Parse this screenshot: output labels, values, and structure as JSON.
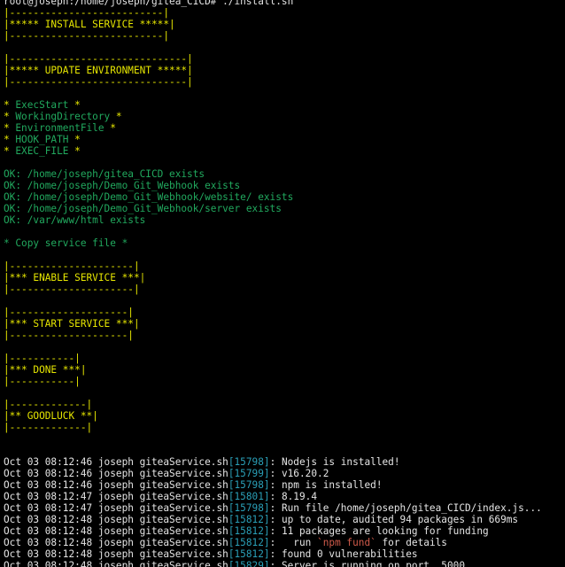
{
  "prompt": {
    "text": "root@joseph:/home/joseph/gitea_CICD# ./install.sh"
  },
  "banners": {
    "install": {
      "top": "|--------------------------|",
      "title": "|***** INSTALL SERVICE *****|",
      "bottom": "|--------------------------|"
    },
    "update": {
      "top": "|------------------------------|",
      "title": "|***** UPDATE ENVIRONMENT *****|",
      "bottom": "|------------------------------|"
    },
    "enable": {
      "top": "|---------------------|",
      "title": "|*** ENABLE SERVICE ***|",
      "bottom": "|---------------------|"
    },
    "start": {
      "top": "|--------------------|",
      "title": "|*** START SERVICE ***|",
      "bottom": "|--------------------|"
    },
    "done": {
      "top": "|-----------|",
      "title": "|*** DONE ***|",
      "bottom": "|-----------|"
    },
    "goodluck": {
      "top": "|-------------|",
      "title": "|** GOODLUCK **|",
      "bottom": "|-------------|"
    }
  },
  "env_vars": [
    {
      "prefix": "* ",
      "name": "ExecStart",
      "suffix": " *"
    },
    {
      "prefix": "* ",
      "name": "WorkingDirectory",
      "suffix": " *"
    },
    {
      "prefix": "* ",
      "name": "EnvironmentFile",
      "suffix": " *"
    },
    {
      "prefix": "* ",
      "name": "HOOK_PATH",
      "suffix": " *"
    },
    {
      "prefix": "* ",
      "name": "EXEC_FILE",
      "suffix": " *"
    }
  ],
  "ok_lines": [
    "OK: /home/joseph/gitea_CICD exists",
    "OK: /home/joseph/Demo_Git_Webhook exists",
    "OK: /home/joseph/Demo_Git_Webhook/website/ exists",
    "OK: /home/joseph/Demo_Git_Webhook/server exists",
    "OK: /var/www/html exists"
  ],
  "copy_line": "* Copy service file *",
  "log": {
    "entries": [
      {
        "time": "Oct 03 08:12:46",
        "host": "joseph",
        "proc": "giteaService.sh",
        "pid": "[15798]",
        "msg": ": Nodejs is installed!"
      },
      {
        "time": "Oct 03 08:12:46",
        "host": "joseph",
        "proc": "giteaService.sh",
        "pid": "[15799]",
        "msg": ": v16.20.2"
      },
      {
        "time": "Oct 03 08:12:46",
        "host": "joseph",
        "proc": "giteaService.sh",
        "pid": "[15798]",
        "msg": ": npm is installed!"
      },
      {
        "time": "Oct 03 08:12:47",
        "host": "joseph",
        "proc": "giteaService.sh",
        "pid": "[15801]",
        "msg": ": 8.19.4"
      },
      {
        "time": "Oct 03 08:12:47",
        "host": "joseph",
        "proc": "giteaService.sh",
        "pid": "[15798]",
        "msg": ": Run file /home/joseph/gitea_CICD/index.js..."
      },
      {
        "time": "Oct 03 08:12:48",
        "host": "joseph",
        "proc": "giteaService.sh",
        "pid": "[15812]",
        "msg": ": up to date, audited 94 packages in 669ms"
      },
      {
        "time": "Oct 03 08:12:48",
        "host": "joseph",
        "proc": "giteaService.sh",
        "pid": "[15812]",
        "msg": ": 11 packages are looking for funding"
      },
      {
        "time": "Oct 03 08:12:48",
        "host": "joseph",
        "proc": "giteaService.sh",
        "pid": "[15812]",
        "msg": ":   run ",
        "cmd": "`npm fund`",
        "tail": " for details"
      },
      {
        "time": "Oct 03 08:12:48",
        "host": "joseph",
        "proc": "giteaService.sh",
        "pid": "[15812]",
        "msg": ": found 0 vulnerabilities"
      },
      {
        "time": "Oct 03 08:12:48",
        "host": "joseph",
        "proc": "giteaService.sh",
        "pid": "[15829]",
        "msg": ": Server is running on port  5000"
      }
    ]
  },
  "colors": {
    "background": "#000000",
    "foreground": "#e5e5e5",
    "banner": "#e5e500",
    "ok": "#21a95e",
    "pid": "#2a9fb7",
    "command": "#d05a4a"
  }
}
